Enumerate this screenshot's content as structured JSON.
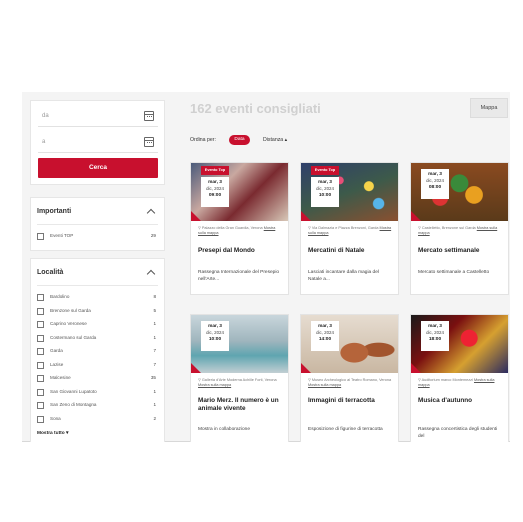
{
  "search": {
    "from_placeholder": "da",
    "to_placeholder": "a",
    "button_label": "Cerca"
  },
  "filters": {
    "importanti": {
      "title": "Importanti",
      "items": [
        {
          "label": "Eventi TOP",
          "count": "29"
        }
      ]
    },
    "localita": {
      "title": "Località",
      "items": [
        {
          "label": "Bardolino",
          "count": "8"
        },
        {
          "label": "Brenzone sul Garda",
          "count": "5"
        },
        {
          "label": "Caprino Veronese",
          "count": "1"
        },
        {
          "label": "Costermano sul Garda",
          "count": "1"
        },
        {
          "label": "Garda",
          "count": "7"
        },
        {
          "label": "Lazise",
          "count": "7"
        },
        {
          "label": "Malcesine",
          "count": "35"
        },
        {
          "label": "San Giovanni Lupatoto",
          "count": "1"
        },
        {
          "label": "San Zeno di Montagna",
          "count": "1"
        },
        {
          "label": "Sona",
          "count": "2"
        }
      ],
      "show_all": "Mostra tutto ▾"
    }
  },
  "header": {
    "count_title": "162 eventi consigliati",
    "map_button": "Mappa",
    "sort_label": "Ordina per:",
    "sort_date": "Data",
    "sort_distance": "Distanza ▴"
  },
  "events": [
    {
      "ribbon": "Evento Top",
      "day": "mar, 3",
      "month": "dic, 2024",
      "time": "09:00",
      "location": "Palazzo della Gran Guardia, Verona",
      "map_link": "Mostra sulla mappa",
      "title": "Presepi dal Mondo",
      "desc": "Rassegna Internazionale del Presepio nell'Arte..."
    },
    {
      "ribbon": "Evento Top",
      "day": "mar, 3",
      "month": "dic, 2024",
      "time": "10:00",
      "location": "Via Dalmazia e Piazza Brenzoni, Garda",
      "map_link": "Mostra sulla mappa",
      "title": "Mercatini di Natale",
      "desc": "Lasciati incantare dalla magia del Natale a..."
    },
    {
      "ribbon": "",
      "day": "mar, 3",
      "month": "dic, 2024",
      "time": "08:00",
      "location": "Castelletto, Brenzone sul Garda",
      "map_link": "Mostra sulla mappa",
      "title": "Mercato settimanale",
      "desc": "Mercato settimanale a Castelletto"
    },
    {
      "ribbon": "",
      "day": "mar, 3",
      "month": "dic, 2024",
      "time": "10:00",
      "location": "Galleria d'Arte Moderna Achille Forti, Verona",
      "map_link": "Mostra sulla mappa",
      "title": "Mario Merz. Il numero è un animale vivente",
      "desc": "Mostra in collaborazione"
    },
    {
      "ribbon": "",
      "day": "mar, 3",
      "month": "dic, 2024",
      "time": "14:00",
      "location": "Museo Archeologico al Teatro Romano, Verona",
      "map_link": "Mostra sulla mappa",
      "title": "Immagini di terracotta",
      "desc": "Esposizione di figurine di terracotta"
    },
    {
      "ribbon": "",
      "day": "mar, 3",
      "month": "dic, 2024",
      "time": "18:00",
      "location": "Auditorium marco Montemezzi",
      "map_link": "Mostra sulla mappa",
      "title": "Musica d'autunno",
      "desc": "Rassegna concertistica degli studenti del"
    }
  ],
  "colors": {
    "accent": "#c8102e"
  }
}
